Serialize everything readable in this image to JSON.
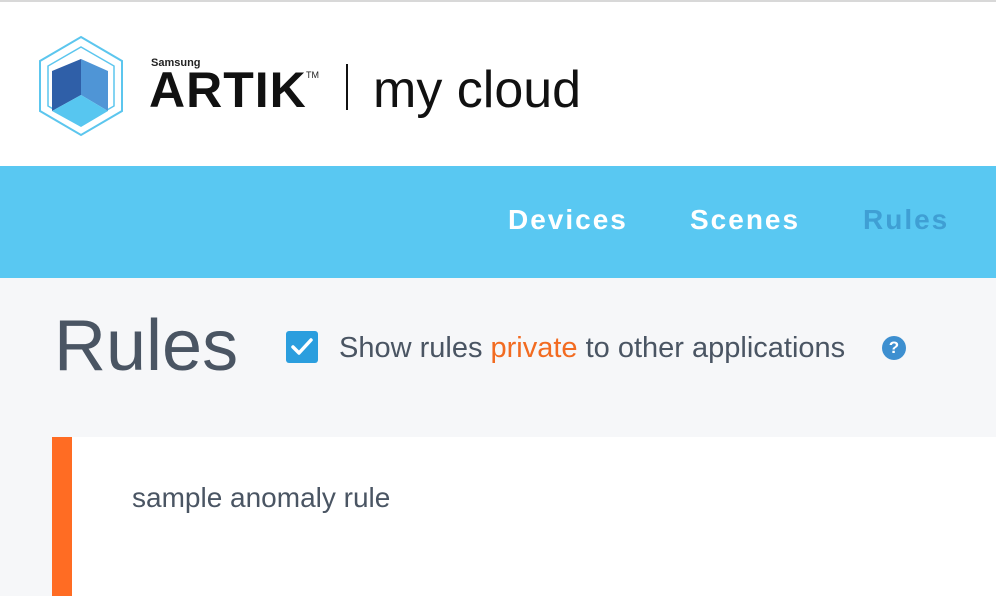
{
  "header": {
    "brand_small": "Samsung",
    "brand_main": "ARTIK",
    "brand_tm": "TM",
    "brand_sub": "my cloud"
  },
  "nav": {
    "items": [
      {
        "label": "Devices",
        "active": false
      },
      {
        "label": "Scenes",
        "active": false
      },
      {
        "label": "Rules",
        "active": true
      }
    ]
  },
  "main": {
    "title": "Rules",
    "private_option": {
      "checked": true,
      "label_prefix": "Show rules ",
      "label_highlight": "private",
      "label_suffix": " to other applications"
    },
    "help_glyph": "?",
    "rules": [
      {
        "name": "sample anomaly rule"
      }
    ]
  },
  "colors": {
    "nav_bg": "#59c8f2",
    "active_nav": "#3f9fd4",
    "accent_orange": "#ff6c23",
    "checkbox_blue": "#2b9ede",
    "text_gray": "#4a5563"
  },
  "icons": {
    "logo": "artik-cube-logo",
    "checkbox": "checkmark-icon",
    "help": "question-circle-icon"
  }
}
